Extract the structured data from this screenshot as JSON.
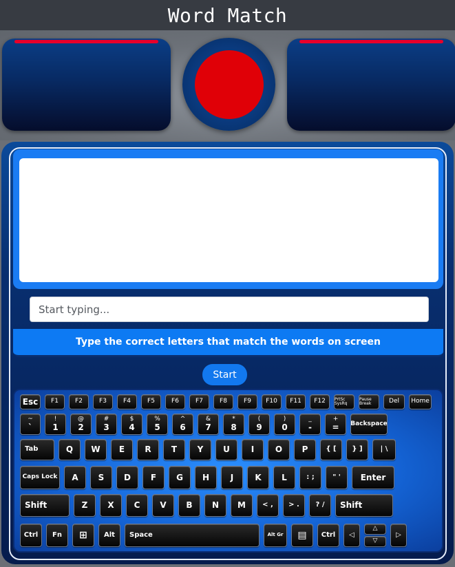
{
  "app": {
    "title": "Word Match"
  },
  "input": {
    "placeholder": "Start typing..."
  },
  "instruction": "Type the correct letters that match the words on screen",
  "start_button": "Start",
  "colors": {
    "accent": "#1278ee",
    "health_bar": "#e8002a",
    "indicator": "#e00007",
    "panel": "#082a63"
  },
  "keyboard": {
    "row1": [
      "Esc",
      "F1",
      "F2",
      "F3",
      "F4",
      "F5",
      "F6",
      "F7",
      "F8",
      "F9",
      "F10",
      "F11",
      "F12",
      "PrtSc SysRq",
      "Pause Break",
      "Del",
      "Home"
    ],
    "row2": [
      {
        "top": "~",
        "bottom": "`"
      },
      {
        "top": "!",
        "bottom": "1"
      },
      {
        "top": "@",
        "bottom": "2"
      },
      {
        "top": "#",
        "bottom": "3"
      },
      {
        "top": "$",
        "bottom": "4"
      },
      {
        "top": "%",
        "bottom": "5"
      },
      {
        "top": "^",
        "bottom": "6"
      },
      {
        "top": "&",
        "bottom": "7"
      },
      {
        "top": "*",
        "bottom": "8"
      },
      {
        "top": "(",
        "bottom": "9"
      },
      {
        "top": ")",
        "bottom": "0"
      },
      {
        "top": "_",
        "bottom": "-"
      },
      {
        "top": "+",
        "bottom": "="
      },
      {
        "top": "",
        "bottom": "Backspace"
      }
    ],
    "row3": [
      "Tab",
      "Q",
      "W",
      "E",
      "R",
      "T",
      "Y",
      "U",
      "I",
      "O",
      "P",
      "{ [",
      "} ]",
      "| \\"
    ],
    "row4": [
      "Caps Lock",
      "A",
      "S",
      "D",
      "F",
      "G",
      "H",
      "J",
      "K",
      "L",
      ": ;",
      "\" '",
      "Enter"
    ],
    "row5": [
      "Shift",
      "Z",
      "X",
      "C",
      "V",
      "B",
      "N",
      "M",
      "< ,",
      "> .",
      "? /",
      "Shift"
    ],
    "row6": [
      "Ctrl",
      "Fn",
      "⊞",
      "Alt",
      "Space",
      "Alt Gr",
      "▤",
      "Ctrl",
      "◁",
      "△",
      "▽",
      "▷"
    ]
  }
}
